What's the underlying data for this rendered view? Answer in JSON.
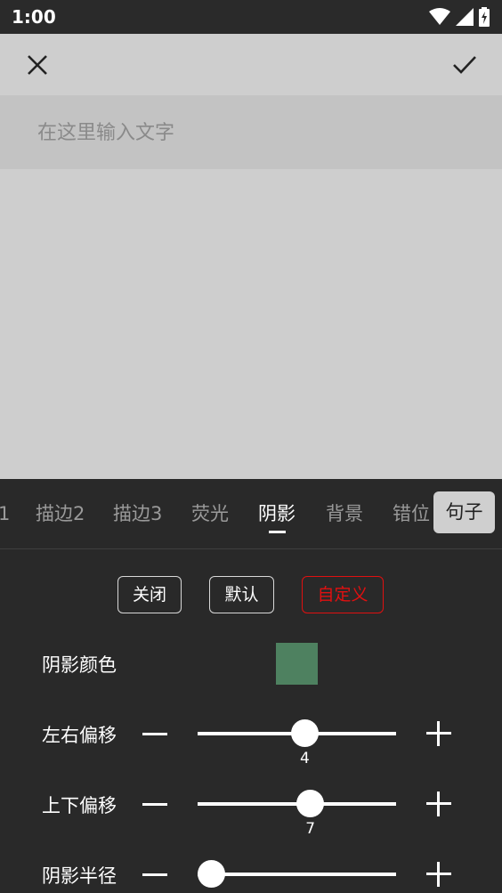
{
  "status_bar": {
    "time": "1:00",
    "icons": [
      "wifi-icon",
      "signal-icon",
      "battery-icon"
    ]
  },
  "toolbar": {
    "close_icon": "close-icon",
    "confirm_icon": "checkmark-icon"
  },
  "text_input": {
    "placeholder": "在这里输入文字",
    "value": ""
  },
  "tabs": {
    "items": [
      {
        "label": "1"
      },
      {
        "label": "描边2"
      },
      {
        "label": "描边3"
      },
      {
        "label": "荧光"
      },
      {
        "label": "阴影"
      },
      {
        "label": "背景"
      },
      {
        "label": "错位"
      }
    ],
    "active": "阴影",
    "pill_label": "句子"
  },
  "modes": {
    "off": "关闭",
    "default": "默认",
    "custom": "自定义",
    "selected": "自定义",
    "selected_color": "#e01010"
  },
  "shadow_color": {
    "label": "阴影颜色",
    "value": "#4e8160"
  },
  "sliders": [
    {
      "label": "左右偏移",
      "value": 4,
      "display": "4",
      "fraction": 0.54
    },
    {
      "label": "上下偏移",
      "value": 7,
      "display": "7",
      "fraction": 0.568
    },
    {
      "label": "阴影半径",
      "fraction": 0.07
    }
  ],
  "colors": {
    "panel_bg": "#292929",
    "canvas_bg": "#cecece",
    "input_bg": "#c3c3c3"
  }
}
